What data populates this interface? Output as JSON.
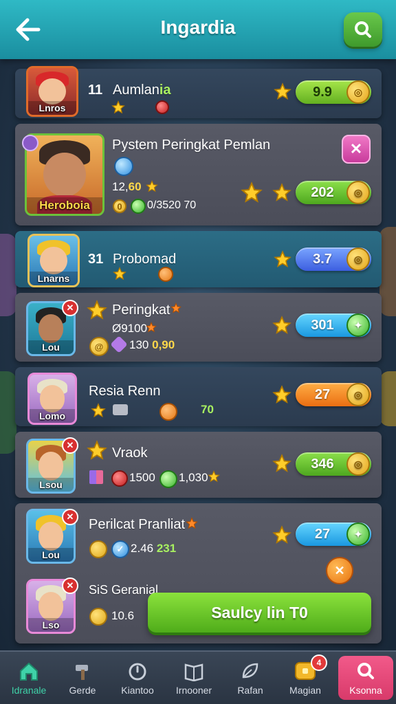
{
  "header": {
    "title": "Ingardia",
    "back_icon": "arrow-left-icon",
    "search_icon": "search-icon"
  },
  "rows": [
    {
      "rank": "11",
      "name": "Aumlan",
      "name_suffix": "ia",
      "avatar_caption": "Lnros",
      "score": "9.9"
    },
    {
      "title": "Pystem Peringkat Pemlan",
      "stat1": "12,",
      "stat1_hl": "60",
      "stat2_prefix": "0",
      "stat2": "0/3520 70",
      "avatar_caption": "Heroboia",
      "score": "202"
    },
    {
      "rank": "31",
      "name": "Probomad",
      "avatar_caption": "Lnarns",
      "score": "3.7"
    },
    {
      "name": "Peringkat",
      "stat1": "Ø9100",
      "stat2": "130",
      "stat2_hl": "0,90",
      "avatar_caption": "Lou",
      "score": "301"
    },
    {
      "name": "Resia Renn",
      "stat_hl": "70",
      "avatar_caption": "Lomo",
      "score": "27"
    },
    {
      "name": "Vraok",
      "stat1": "1500",
      "stat2": "1,030",
      "avatar_caption": "Lsou",
      "score": "346"
    },
    {
      "name": "Perilcat Pranliat",
      "stat1": "2.46",
      "stat1_hl": "231",
      "avatar_caption": "Lou",
      "score": "27"
    },
    {
      "name": "SiS Geranial",
      "stat1": "10.6",
      "avatar_caption": "Lso"
    }
  ],
  "cta": {
    "label": "Saulcy lin T0"
  },
  "nav": [
    {
      "label": "Idranale",
      "icon": "home-icon"
    },
    {
      "label": "Gerde",
      "icon": "hammer-icon"
    },
    {
      "label": "Kiantoo",
      "icon": "timer-icon"
    },
    {
      "label": "Irnooner",
      "icon": "book-icon"
    },
    {
      "label": "Rafan",
      "icon": "leaf-icon"
    },
    {
      "label": "Magian",
      "icon": "chest-icon",
      "badge": "4"
    },
    {
      "label": "Ksonna",
      "icon": "search-icon"
    }
  ],
  "colors": {
    "header": "#2fb9c5",
    "accent_green": "#64b021",
    "accent_pink": "#e05aae"
  }
}
